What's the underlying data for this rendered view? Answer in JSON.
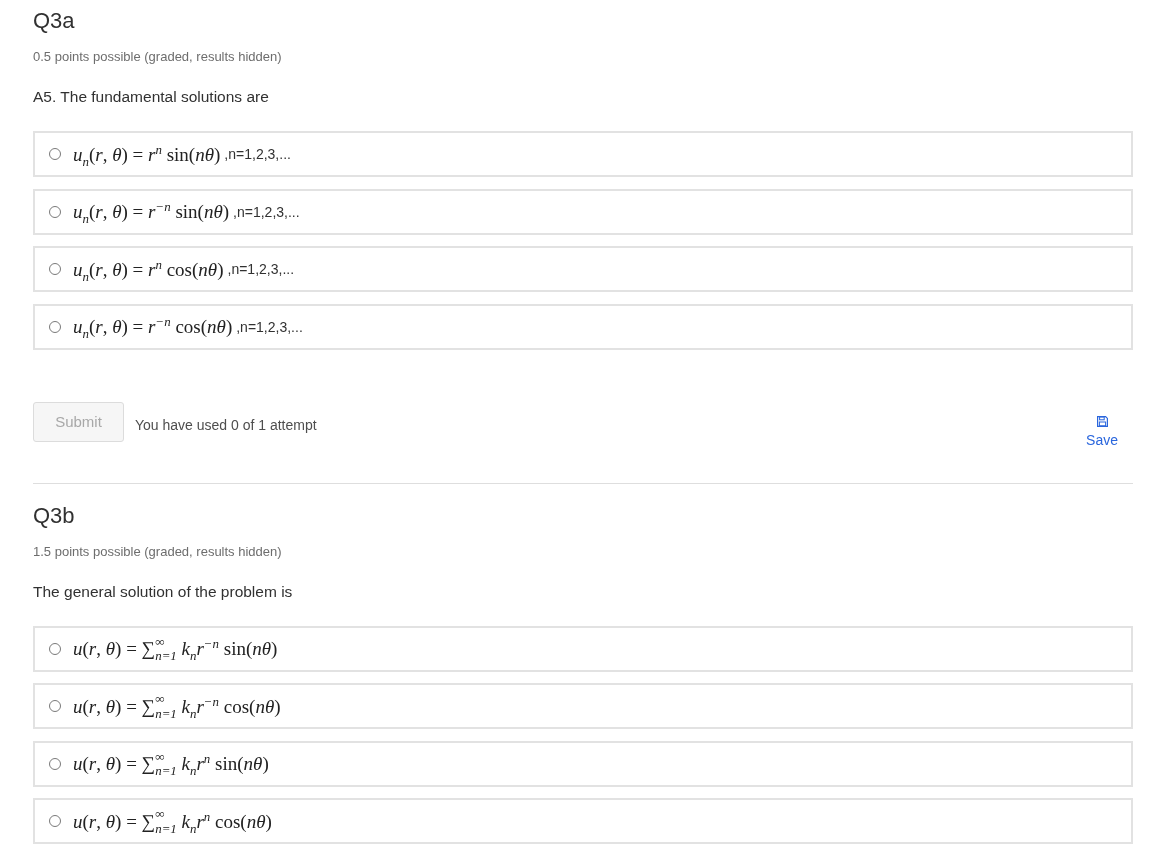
{
  "problems": [
    {
      "title": "Q3a",
      "points": "0.5 points possible (graded, results hidden)",
      "prompt": "A5. The fundamental solutions are",
      "options": [
        {
          "formula": "*u*$_{n}$(*r*, *θ*) = *r*$^{n}$ sin(*nθ*)",
          "note": ",n=1,2,3,...",
          "selected": false
        },
        {
          "formula": "*u*$_{n}$(*r*, *θ*) = *r*$^{−n}$ sin(*nθ*)",
          "note": ",n=1,2,3,...",
          "selected": false
        },
        {
          "formula": "*u*$_{n}$(*r*, *θ*) = *r*$^{n}$ cos(*nθ*)",
          "note": ",n=1,2,3,...",
          "selected": false
        },
        {
          "formula": "*u*$_{n}$(*r*, *θ*) = *r*$^{−n}$ cos(*nθ*)",
          "note": ",n=1,2,3,...",
          "selected": false
        }
      ],
      "submit": {
        "label": "Submit",
        "disabled": true
      },
      "attempts": "You have used 0 of 1 attempt",
      "save": {
        "label": "Save"
      }
    },
    {
      "title": "Q3b",
      "points": "1.5 points possible (graded, results hidden)",
      "prompt": "The general solution of the problem is",
      "options": [
        {
          "formula": "*u*(*r*, *θ*) = ∑$^{∞}$$_{n=1}$ *k*$_{n}$*r*$^{−n}$ sin(*nθ*)",
          "selected": false
        },
        {
          "formula": "*u*(*r*, *θ*) = ∑$^{∞}$$_{n=1}$ *k*$_{n}$*r*$^{−n}$ cos(*nθ*)",
          "selected": false
        },
        {
          "formula": "*u*(*r*, *θ*) = ∑$^{∞}$$_{n=1}$ *k*$_{n}$*r*$^{n}$ sin(*nθ*)",
          "selected": false
        },
        {
          "formula": "*u*(*r*, *θ*) = ∑$^{∞}$$_{n=1}$ *k*$_{n}$*r*$^{n}$ cos(*nθ*)",
          "selected": false
        }
      ]
    }
  ]
}
